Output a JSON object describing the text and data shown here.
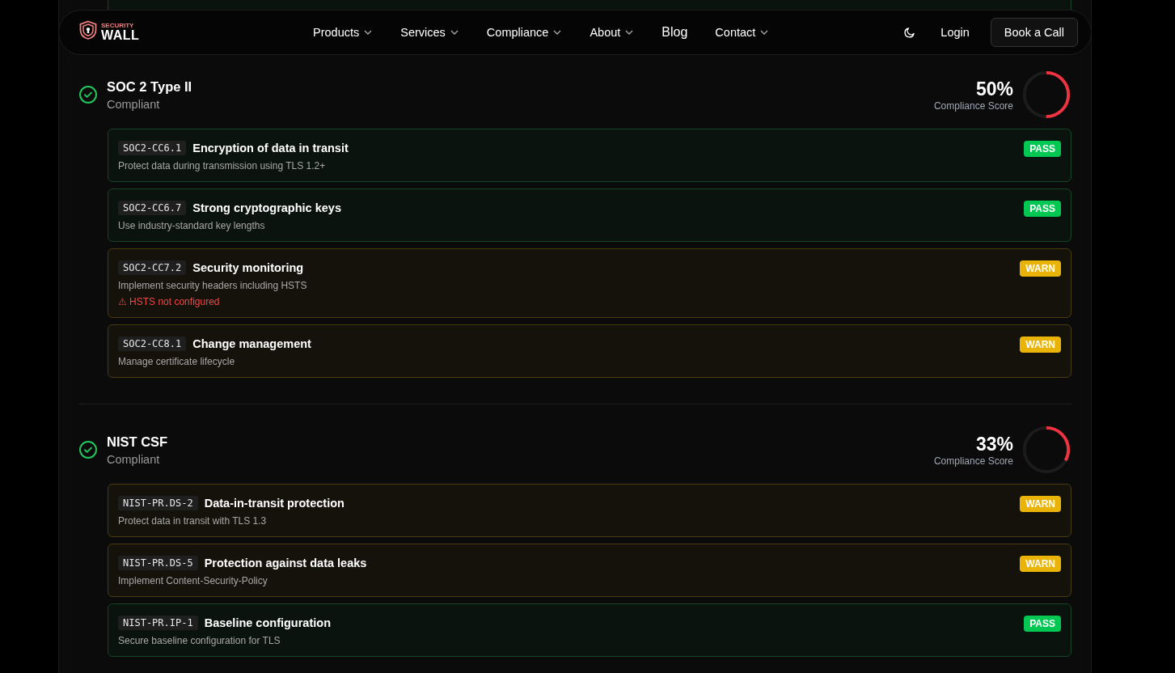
{
  "nav": {
    "logo": {
      "top": "SECURITY",
      "bottom": "WALL"
    },
    "items": [
      {
        "label": "Products",
        "dropdown": true
      },
      {
        "label": "Services",
        "dropdown": true
      },
      {
        "label": "Compliance",
        "dropdown": true
      },
      {
        "label": "About",
        "dropdown": true
      },
      {
        "label": "Blog",
        "dropdown": false
      },
      {
        "label": "Contact",
        "dropdown": true
      }
    ],
    "login": "Login",
    "cta": "Book a Call"
  },
  "previous_check": {
    "kind": "pass"
  },
  "frameworks": [
    {
      "name": "SOC 2 Type II",
      "state": "Compliant",
      "score": "50%",
      "score_label": "Compliance Score",
      "level": 0.5,
      "checks": [
        {
          "code": "SOC2-CC6.1",
          "title": "Encryption of data in transit",
          "description": "Protect data during transmission using TLS 1.2+",
          "kind": "pass",
          "badge": "PASS"
        },
        {
          "code": "SOC2-CC6.7",
          "title": "Strong cryptographic keys",
          "description": "Use industry-standard key lengths",
          "kind": "pass",
          "badge": "PASS"
        },
        {
          "code": "SOC2-CC7.2",
          "title": "Security monitoring",
          "description": "Implement security headers including HSTS",
          "issue": "⚠ HSTS not configured",
          "kind": "warn",
          "badge": "WARN"
        },
        {
          "code": "SOC2-CC8.1",
          "title": "Change management",
          "description": "Manage certificate lifecycle",
          "kind": "warn",
          "badge": "WARN"
        }
      ]
    },
    {
      "name": "NIST CSF",
      "state": "Compliant",
      "score": "33%",
      "score_label": "Compliance Score",
      "level": 0.33,
      "checks": [
        {
          "code": "NIST-PR.DS-2",
          "title": "Data-in-transit protection",
          "description": "Protect data in transit with TLS 1.3",
          "kind": "warn",
          "badge": "WARN"
        },
        {
          "code": "NIST-PR.DS-5",
          "title": "Protection against data leaks",
          "description": "Implement Content-Security-Policy",
          "kind": "warn",
          "badge": "WARN"
        },
        {
          "code": "NIST-PR.IP-1",
          "title": "Baseline configuration",
          "description": "Secure baseline configuration for TLS",
          "kind": "pass",
          "badge": "PASS"
        }
      ]
    }
  ]
}
